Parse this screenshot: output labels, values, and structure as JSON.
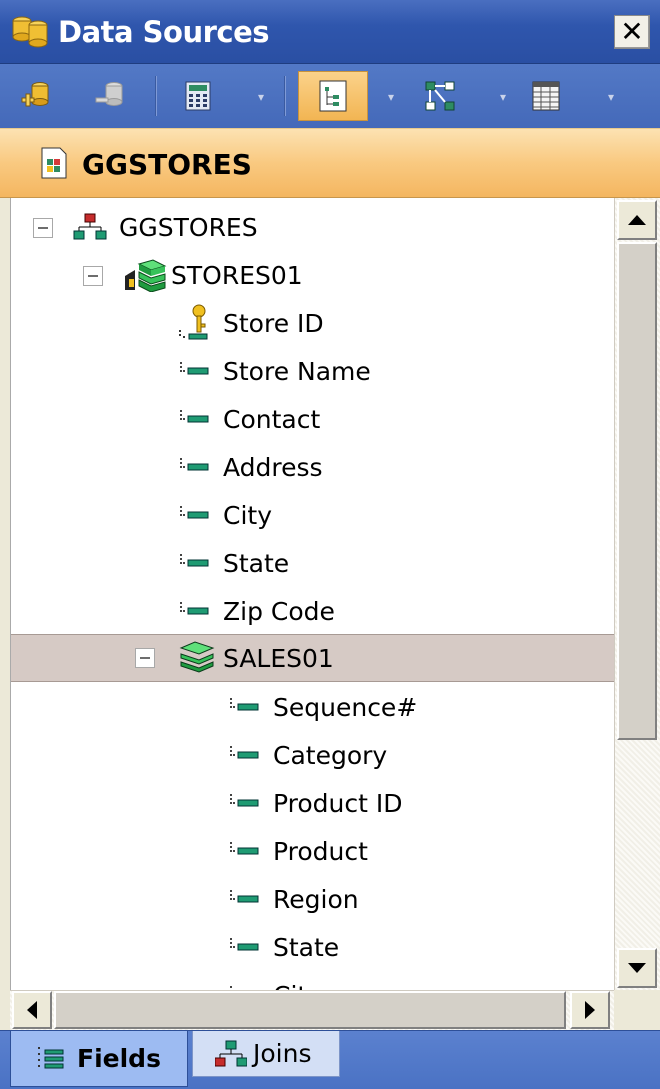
{
  "window": {
    "title": "Data Sources",
    "close_glyph": "✕"
  },
  "toolbar": {
    "buttons": [
      {
        "icon": "add-data-source-icon"
      },
      {
        "icon": "remove-data-source-icon"
      },
      {
        "icon": "calculated-field-icon"
      },
      {
        "icon": "tree-view-icon",
        "active": true
      },
      {
        "icon": "join-view-icon"
      },
      {
        "icon": "list-view-icon"
      }
    ]
  },
  "source_header": {
    "title": "GGSTORES"
  },
  "tree": {
    "root": {
      "label": "GGSTORES"
    },
    "segments": [
      {
        "label": "STORES01",
        "fields": [
          {
            "label": "Store ID",
            "key": true
          },
          {
            "label": "Store Name"
          },
          {
            "label": "Contact"
          },
          {
            "label": "Address"
          },
          {
            "label": "City"
          },
          {
            "label": "State"
          },
          {
            "label": "Zip Code"
          }
        ]
      },
      {
        "label": "SALES01",
        "selected": true,
        "fields": [
          {
            "label": "Sequence#"
          },
          {
            "label": "Category"
          },
          {
            "label": "Product ID"
          },
          {
            "label": "Product"
          },
          {
            "label": "Region"
          },
          {
            "label": "State"
          },
          {
            "label": "City"
          }
        ]
      }
    ]
  },
  "tabs": [
    {
      "label": "Fields",
      "active": true
    },
    {
      "label": "Joins",
      "active": false
    }
  ],
  "colors": {
    "title_bar": "#2f56ad",
    "header_orange": "#f9c980",
    "selected_row": "#d6cac5",
    "field_green": "#1f9b73"
  }
}
